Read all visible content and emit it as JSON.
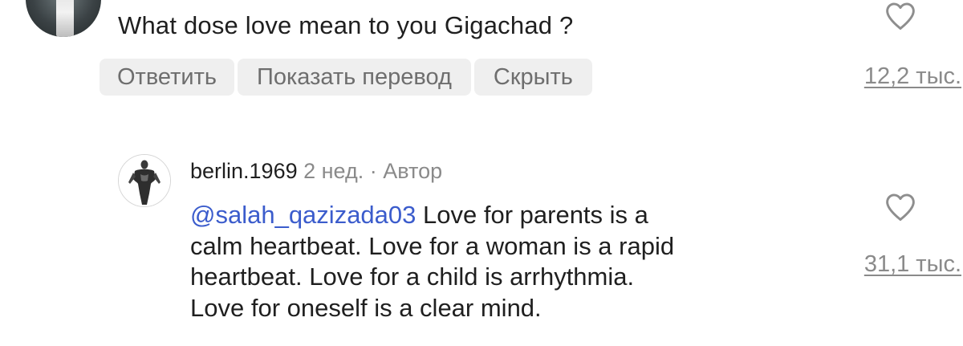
{
  "comment": {
    "text": "What dose love mean to you Gigachad ?",
    "likes": "12,2 тыс.",
    "actions": {
      "reply_label": "Ответить",
      "translate_label": "Показать перевод",
      "hide_label": "Скрыть"
    }
  },
  "reply": {
    "username": "berlin.1969",
    "time": "2 нед.",
    "separator": "·",
    "author_badge": "Автор",
    "mention": "@salah_qazizada03",
    "lines": {
      "l1": " Love for parents is a",
      "l2": "calm heartbeat. Love for a woman is a rapid",
      "l3": "heartbeat. Love for a child is arrhythmia.",
      "l4": "Love for oneself is a clear mind."
    },
    "likes": "31,1 тыс."
  },
  "icons": {
    "like": "heart-outline-icon",
    "avatar_top": "user-avatar",
    "avatar_reply": "author-avatar"
  },
  "colors": {
    "mention": "#3b5ccc",
    "secondary_text": "#8a8a8a",
    "button_bg": "#efefef",
    "button_text": "#6e6e6e"
  }
}
